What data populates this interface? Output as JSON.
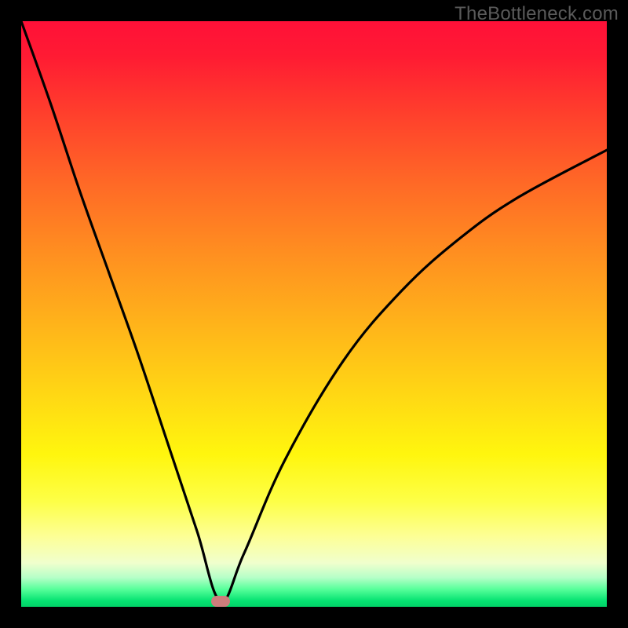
{
  "watermark": "TheBottleneck.com",
  "chart_data": {
    "type": "line",
    "title": "",
    "xlabel": "",
    "ylabel": "",
    "x_range": [
      0,
      100
    ],
    "y_range": [
      0,
      100
    ],
    "optimum_x": 34,
    "gradient_meaning": "bottleneck severity (top=high/red, bottom=low/green)",
    "series": [
      {
        "name": "bottleneck-curve",
        "x": [
          0,
          5,
          10,
          15,
          20,
          25,
          30,
          34,
          38,
          45,
          55,
          65,
          75,
          85,
          100
        ],
        "y": [
          100,
          86,
          71,
          57,
          43,
          28,
          13,
          1,
          9,
          25,
          42,
          54,
          63,
          70,
          78
        ]
      }
    ],
    "marker": {
      "x": 34,
      "y": 1,
      "color": "#cd7d7c"
    },
    "colors": {
      "curve": "#000000",
      "background_top": "#ff1038",
      "background_bottom": "#02d268",
      "frame": "#000000",
      "watermark": "#5a5a5a"
    }
  }
}
